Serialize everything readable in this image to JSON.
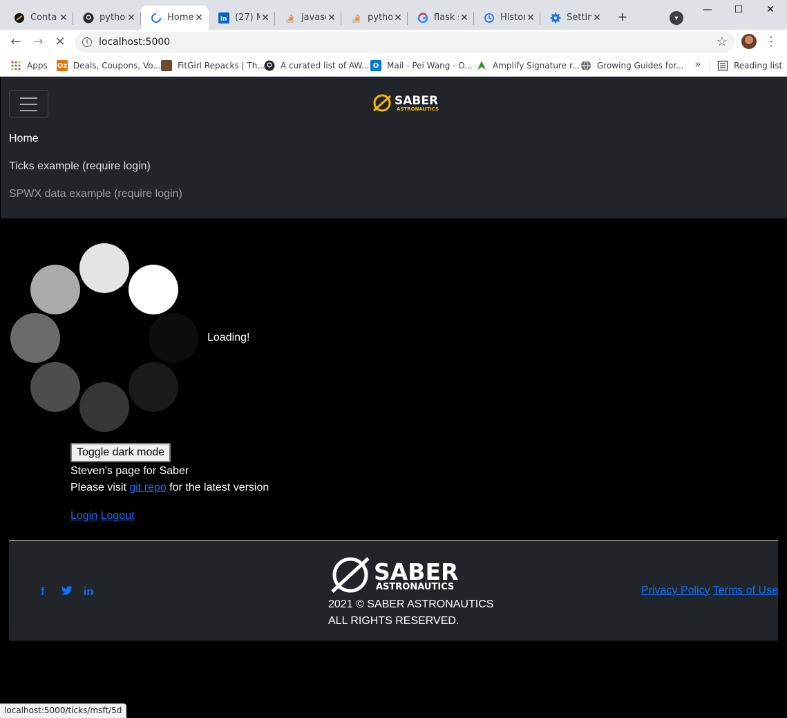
{
  "browser": {
    "tabs": [
      {
        "title": "Conta",
        "icon": "saber-icon"
      },
      {
        "title": "pytho",
        "icon": "github-icon"
      },
      {
        "title": "Home",
        "icon": "loading-spinner-icon",
        "active": true
      },
      {
        "title": "(27) M",
        "icon": "linkedin-icon"
      },
      {
        "title": "javasc",
        "icon": "stackoverflow-icon"
      },
      {
        "title": "pytho",
        "icon": "stackoverflow-icon"
      },
      {
        "title": "flask s",
        "icon": "google-icon"
      },
      {
        "title": "Histor",
        "icon": "history-icon"
      },
      {
        "title": "Settin",
        "icon": "settings-gear-icon"
      }
    ],
    "url": "localhost:5000",
    "bookmarks": [
      {
        "label": "Apps",
        "icon": "apps-grid-icon"
      },
      {
        "label": "Deals, Coupons, Vo...",
        "icon": "oz-icon"
      },
      {
        "label": "FitGirl Repacks | Th...",
        "icon": "fitgirl-icon"
      },
      {
        "label": "A curated list of AW...",
        "icon": "github-icon"
      },
      {
        "label": "Mail - Pei Wang - O...",
        "icon": "outlook-icon"
      },
      {
        "label": "Amplify Signature r...",
        "icon": "amplify-icon"
      },
      {
        "label": "Growing Guides for...",
        "icon": "globe-icon"
      }
    ],
    "more_bookmarks": "»",
    "reading_list": "Reading list",
    "status_url": "localhost:5000/ticks/msft/5d"
  },
  "page": {
    "brand_small": {
      "line1": "SABER",
      "line2": "ASTRONAUTICS"
    },
    "nav": {
      "home": "Home",
      "ticks": "Ticks example (require login)",
      "spwx": "SPWX data example (require login)"
    },
    "loading": "Loading!",
    "toggle_button": "Toggle dark mode",
    "tagline": "Steven's page for Saber",
    "visit_prefix": "Please visit",
    "visit_link": "git repo",
    "visit_suffix": "for the latest version",
    "login": "Login",
    "logout": "Logout"
  },
  "footer": {
    "logo_line1": "SABER",
    "logo_line2": "ASTRONAUTICS",
    "copyright": "2021 © SABER ASTRONAUTICS",
    "rights": "ALL RIGHTS RESERVED.",
    "privacy": "Privacy Policy",
    "terms": "Terms of Use",
    "social": [
      {
        "icon": "facebook-icon",
        "glyph": "f"
      },
      {
        "icon": "twitter-icon",
        "glyph": "t"
      },
      {
        "icon": "linkedin-icon",
        "glyph": "in"
      }
    ]
  },
  "colors": {
    "navbar_bg": "#212529",
    "link": "#0d6efd",
    "brand_accent": "#f5b800"
  }
}
